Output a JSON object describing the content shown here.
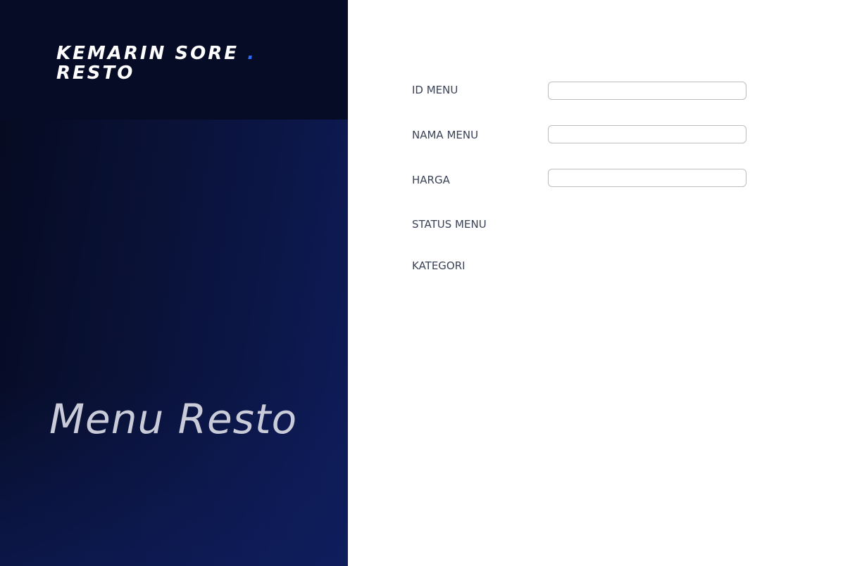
{
  "sidebar": {
    "brand_line1": "KEMARIN SORE",
    "brand_dot": ".",
    "brand_line2": "RESTO",
    "hero_title": "Menu Resto"
  },
  "form": {
    "id_menu_label": "ID MENU",
    "id_menu_value": "",
    "nama_menu_label": "NAMA MENU",
    "nama_menu_value": "",
    "harga_label": "HARGA",
    "harga_value": "",
    "status_menu_label": "STATUS MENU",
    "kategori_label": "KATEGORI"
  },
  "colors": {
    "panel_dark": "#060c26",
    "panel_gradient_end": "#0e1c5a",
    "brand_dot": "#2b6cff",
    "hero_text": "#c9ccd8",
    "label_text": "#3a4256"
  }
}
